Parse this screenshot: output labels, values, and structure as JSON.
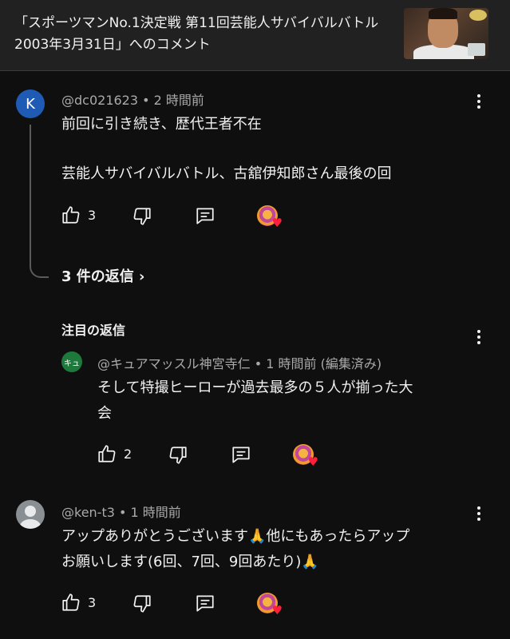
{
  "header": {
    "title": "「スポーツマンNo.1決定戦 第11回芸能人サバイバルバトル 2003年3月31日」へのコメント"
  },
  "comment1": {
    "avatar_letter": "K",
    "meta": "@dc021623 • 2 時間前",
    "line1": "前回に引き続き、歴代王者不在",
    "line2": "芸能人サバイバルバトル、古舘伊知郎さん最後の回",
    "like_count": "3"
  },
  "replies_link": "3 件の返信 ›",
  "featured_label": "注目の返信",
  "reply1": {
    "avatar_text": "キュ",
    "meta": "@キュアマッスル神宮寺仁 • 1 時間前 (編集済み)",
    "line1": "そして特撮ヒーローが過去最多の５人が揃った大",
    "line2": "会",
    "like_count": "2"
  },
  "comment2": {
    "meta": "@ken-t3 • 1 時間前",
    "line1": "アップありがとうございます🙏他にもあったらアップ",
    "line2": "お願いします(6回、7回、9回あたり)🙏",
    "like_count": "3"
  },
  "icons": {
    "like": "thumbs-up-icon",
    "dislike": "thumbs-down-icon",
    "reply": "comment-icon",
    "creator_heart": "creator-heart-icon",
    "menu": "more-vert-icon"
  },
  "colors": {
    "background": "#0f0f0f",
    "header": "#212121",
    "text": "#f1f1f1",
    "meta": "#aaaaaa",
    "heart": "#ff1f3d"
  }
}
